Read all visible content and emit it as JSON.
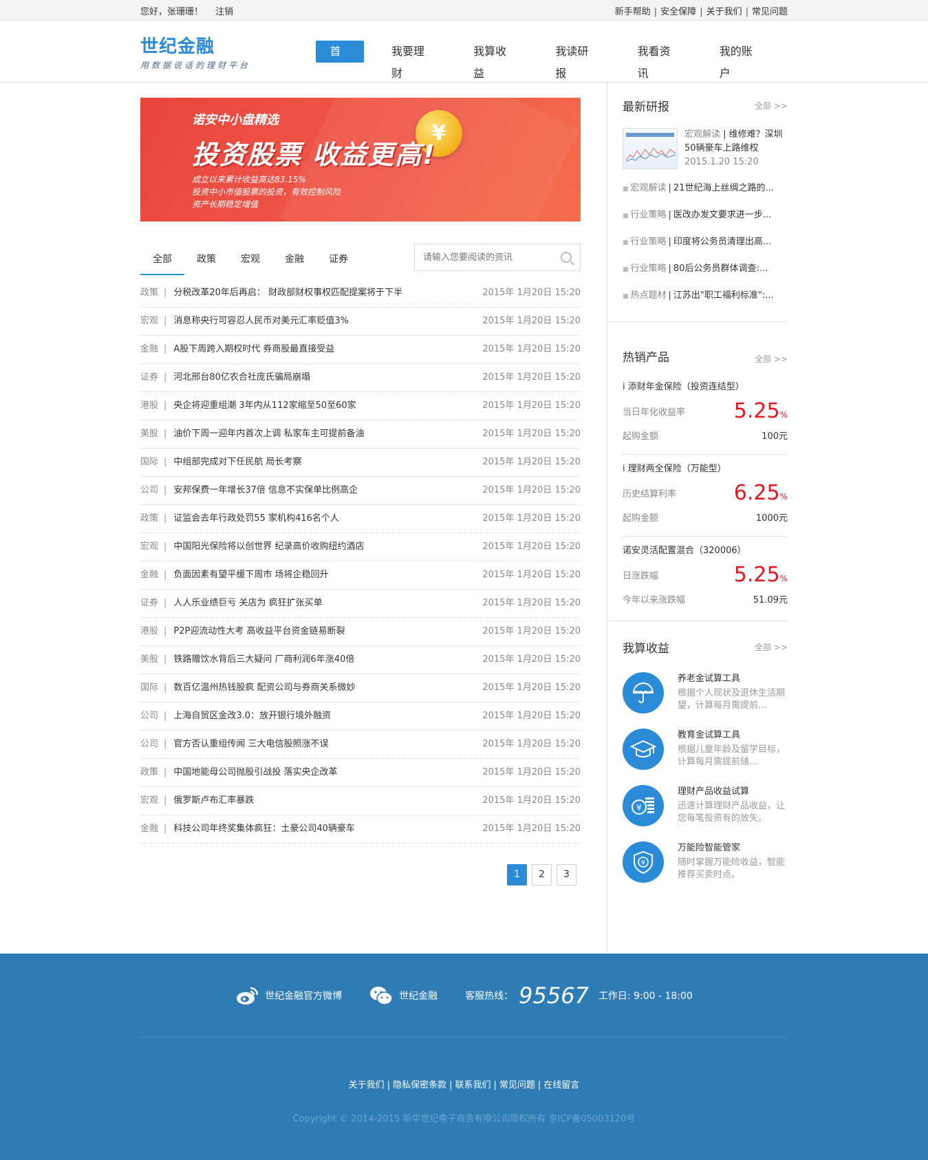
{
  "topbar": {
    "greeting": "您好，张珊珊！",
    "logout": "注销",
    "links": [
      "新手帮助",
      "安全保障",
      "关于我们",
      "常见问题"
    ]
  },
  "header": {
    "logo_title": "世纪金融",
    "logo_slogan": "用数据说话的理财平台",
    "nav": [
      "首页",
      "我要理财",
      "我算收益",
      "我读研报",
      "我看资讯",
      "我的账户"
    ]
  },
  "banner": {
    "line1": "诺安中小盘精选",
    "line2": "投资股票  收益更高!",
    "line3": "成立以来累计收益高达83.15%",
    "line4": "投资中小市值股票的投资，有效控制风险",
    "line5": "资产长期稳定增值",
    "coin_glyph": "¥"
  },
  "tabs": [
    "全部",
    "政策",
    "宏观",
    "金融",
    "证券"
  ],
  "search": {
    "placeholder": "请输入您要阅读的资讯"
  },
  "news": [
    {
      "cat": "政策",
      "title": "分税改革20年后再启： 财政部财权事权匹配提案将于下半",
      "date": "2015年 1月20日 15:20"
    },
    {
      "cat": "宏观",
      "title": "消息称央行可容忍人民币对美元汇率贬值3%",
      "date": "2015年 1月20日 15:20"
    },
    {
      "cat": "金融",
      "title": "A股下周跨入期权时代 券商股最直接受益",
      "date": "2015年 1月20日 15:20"
    },
    {
      "cat": "证券",
      "title": "河北邢台80亿农合社庞氏骗局崩塌",
      "date": "2015年 1月20日 15:20"
    },
    {
      "cat": "港股",
      "title": "央企将迎重组潮 3年内从112家缩至50至60家",
      "date": "2015年 1月20日 15:20"
    },
    {
      "cat": "美股",
      "title": "油价下周一迎年内首次上调 私家车主可提前备油",
      "date": "2015年 1月20日 15:20"
    },
    {
      "cat": "国际",
      "title": "中组部完成对下任民航 局长考察",
      "date": "2015年 1月20日 15:20"
    },
    {
      "cat": "公司",
      "title": "安邦保费一年增长37倍 信息不实保单比例高企",
      "date": "2015年 1月20日 15:20"
    },
    {
      "cat": "政策",
      "title": "证监会去年行政处罚55 家机构416名个人",
      "date": "2015年 1月20日 15:20"
    },
    {
      "cat": "宏观",
      "title": "中国阳光保险将以创世界 纪录高价收购纽约酒店",
      "date": "2015年 1月20日 15:20"
    },
    {
      "cat": "金融",
      "title": "负面因素有望平缓下周市 场将企稳回升",
      "date": "2015年 1月20日 15:20"
    },
    {
      "cat": "证券",
      "title": "人人乐业绩巨亏 关店为 疯狂扩张买单",
      "date": "2015年 1月20日 15:20"
    },
    {
      "cat": "港股",
      "title": "P2P迎流动性大考 高收益平台资金链易断裂",
      "date": "2015年 1月20日 15:20"
    },
    {
      "cat": "美股",
      "title": "铁路赠饮水背后三大疑问 厂商利润6年涨40倍",
      "date": "2015年 1月20日 15:20"
    },
    {
      "cat": "国际",
      "title": "数百亿温州热钱股疯 配资公司与券商关系微妙",
      "date": "2015年 1月20日 15:20"
    },
    {
      "cat": "公司",
      "title": "上海自贸区金改3.0：放开银行境外融资",
      "date": "2015年 1月20日 15:20"
    },
    {
      "cat": "公司",
      "title": "官方否认重组传闻 三大电信股照涨不误",
      "date": "2015年 1月20日 15:20"
    },
    {
      "cat": "政策",
      "title": "中国地能母公司抛股引战投 落实央企改革",
      "date": "2015年 1月20日 15:20"
    },
    {
      "cat": "宏观",
      "title": "俄罗斯卢布汇率暴跌",
      "date": "2015年 1月20日 15:20"
    },
    {
      "cat": "金融",
      "title": "科技公司年终奖集体疯狂：土豪公司40辆豪车",
      "date": "2015年 1月20日 15:20"
    }
  ],
  "pager": [
    "1",
    "2",
    "3"
  ],
  "sidebar": {
    "reports": {
      "title": "最新研报",
      "more": "全部 >>",
      "top": {
        "cat": "宏观解读",
        "title": "维修难？深圳50辆豪车上路维权",
        "date": "2015.1.20 15:20"
      },
      "items": [
        {
          "cat": "宏观解读",
          "title": "21世纪海上丝绸之路的..."
        },
        {
          "cat": "行业策略",
          "title": "医改办发文要求进一步..."
        },
        {
          "cat": "行业策略",
          "title": "印度将公务员清理出高..."
        },
        {
          "cat": "行业策略",
          "title": "80后公务员群体调查:..."
        },
        {
          "cat": "热点题材",
          "title": "江苏出\"职工福利标准\":..."
        }
      ]
    },
    "products": {
      "title": "热销产品",
      "more": "全部 >>",
      "items": [
        {
          "name": "i 添财年金保险（投资连结型）",
          "rate_label": "当日年化收益率",
          "rate": "5.25",
          "unit": "%",
          "min_label": "起购金额",
          "min": "100元"
        },
        {
          "name": "i 理财两全保险（万能型）",
          "rate_label": "历史结算利率",
          "rate": "6.25",
          "unit": "%",
          "min_label": "起购金额",
          "min": "1000元"
        },
        {
          "name": "诺安灵活配置混合（320006）",
          "rate_label": "日涨跌幅",
          "rate": "5.25",
          "unit": "%",
          "min_label": "今年以来涨跌幅",
          "min": "51.09元"
        }
      ]
    },
    "tools": {
      "title": "我算收益",
      "more": "全部 >>",
      "items": [
        {
          "name": "养老金试算工具",
          "desc": "根据个人现状及退休生活期望，计算每月需提前...",
          "icon": "umbrella-icon"
        },
        {
          "name": "教育金试算工具",
          "desc": "根据儿童年龄及留学目标，计算每月需提前储...",
          "icon": "graduation-cap-icon"
        },
        {
          "name": "理财产品收益试算",
          "desc": "迅速计算理财产品收益，让您每笔投资有的放矢。",
          "icon": "yuan-coins-icon"
        },
        {
          "name": "万能险智能管家",
          "desc": "随时掌握万能险收益，智能推荐买卖时点。",
          "icon": "yuan-shield-icon"
        }
      ]
    }
  },
  "footer": {
    "weibo": "世纪金融官方微博",
    "wechat": "世纪金融",
    "hotline_label": "客服热线：",
    "hotline": "95567",
    "hours": "工作日: 9:00 - 18:00",
    "links": [
      "关于我们",
      "隐私保密条款",
      "联系我们",
      "常见问题",
      "在线留言"
    ],
    "copyright": "Copyright © 2014-2015 新华世纪电子商务有限公司版权所有 京ICP备05003120号"
  },
  "colors": {
    "accent": "#2a8bd8",
    "footer_bg": "#2d7cb6",
    "rate_red": "#e4161e",
    "banner_red": "#ee4e42"
  }
}
